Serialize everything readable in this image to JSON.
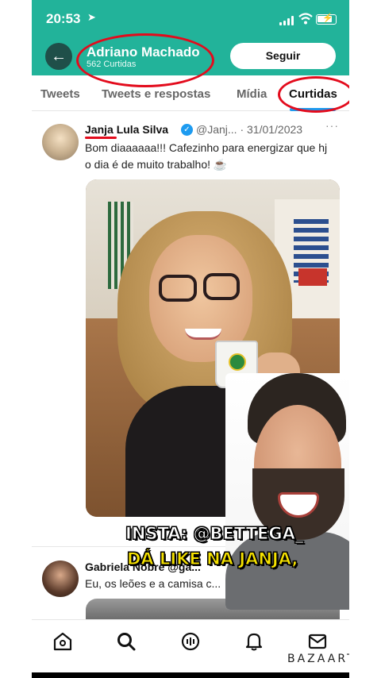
{
  "status_bar": {
    "time": "20:53",
    "location_arrow": "➤"
  },
  "header": {
    "back_icon": "←",
    "profile_name": "Adriano Machado",
    "likes_count": "562 Curtidas",
    "follow_label": "Seguir"
  },
  "tabs": [
    {
      "label": "Tweets",
      "active": false
    },
    {
      "label": "Tweets e respostas",
      "active": false
    },
    {
      "label": "Mídia",
      "active": false
    },
    {
      "label": "Curtidas",
      "active": true
    }
  ],
  "tweet1": {
    "author": "Janja Lula Silva",
    "handle": "@Janj... · 31/01/2023",
    "more": "···",
    "verified": "✓",
    "text": "Bom diaaaaaa!!! Cafezinho para energizar que hj o dia é de muito trabalho! ☕"
  },
  "tweet2": {
    "author": "Gabriela Nobre @ga...",
    "text": "Eu, os leões e a camisa c..."
  },
  "captions": {
    "line1": "INSTA: @BETTEGA_",
    "line2": "DÁ LIKE NA JANJA,"
  },
  "watermark": "BAZAART",
  "colors": {
    "header_bg": "#22b39a",
    "accent_blue": "#1d9bf0",
    "annotation_red": "#e30b1c",
    "caption_yellow": "#f5e100"
  },
  "icons": {
    "nav": [
      "home-icon",
      "search-icon",
      "spaces-icon",
      "notifications-icon",
      "messages-icon"
    ]
  }
}
